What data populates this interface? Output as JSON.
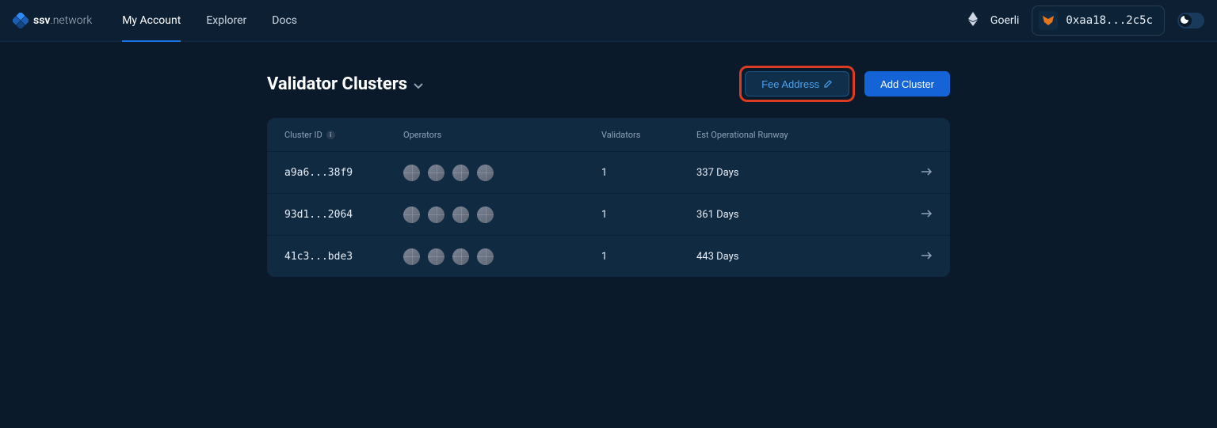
{
  "brand": {
    "name_bold": "ssv",
    "name_thin": ".network"
  },
  "nav": {
    "my_account": "My Account",
    "explorer": "Explorer",
    "docs": "Docs"
  },
  "topbar": {
    "network": "Goerli",
    "wallet_address": "0xaa18...2c5c"
  },
  "page": {
    "title": "Validator Clusters"
  },
  "actions": {
    "fee_address": "Fee Address",
    "add_cluster": "Add Cluster"
  },
  "table": {
    "headers": {
      "cluster_id": "Cluster ID",
      "operators": "Operators",
      "validators": "Validators",
      "runway": "Est Operational Runway"
    },
    "rows": [
      {
        "id": "a9a6...38f9",
        "operator_count": 4,
        "validators": "1",
        "runway": "337 Days"
      },
      {
        "id": "93d1...2064",
        "operator_count": 4,
        "validators": "1",
        "runway": "361 Days"
      },
      {
        "id": "41c3...bde3",
        "operator_count": 4,
        "validators": "1",
        "runway": "443 Days"
      }
    ]
  },
  "colors": {
    "accent": "#1464d8",
    "link": "#4aa3f0",
    "bg": "#0b1a2b",
    "panel": "#102a42",
    "highlight_border": "#db3b21"
  }
}
